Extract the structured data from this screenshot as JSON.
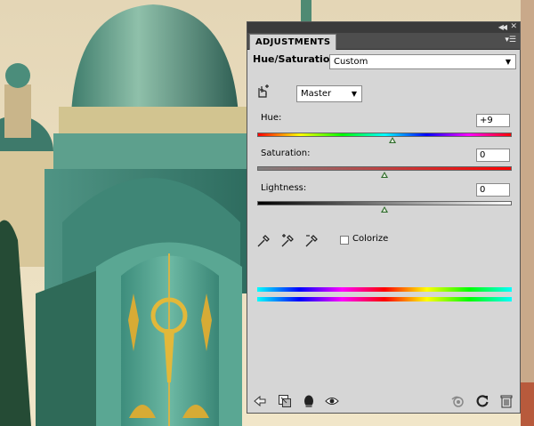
{
  "panel": {
    "tab_label": "ADJUSTMENTS",
    "adjustment_title": "Hue/Saturation",
    "preset": {
      "selected": "Custom"
    },
    "channel": {
      "selected": "Master"
    },
    "hue": {
      "label": "Hue:",
      "value": "+9",
      "slider_fraction": 0.53
    },
    "saturation": {
      "label": "Saturation:",
      "value": "0",
      "slider_fraction": 0.5
    },
    "lightness": {
      "label": "Lightness:",
      "value": "0",
      "slider_fraction": 0.5
    },
    "colorize": {
      "label": "Colorize",
      "checked": false
    },
    "icons": {
      "header": [
        "collapse-icon",
        "close-icon",
        "panel-menu-icon"
      ],
      "tools": [
        "on-image-adjust-icon",
        "eyedropper-icon",
        "eyedropper-plus-icon",
        "eyedropper-minus-icon"
      ],
      "footer": [
        "back-arrow-icon",
        "clip-to-layer-icon",
        "visibility-eye-icon",
        "view-previous-icon",
        "reset-icon",
        "trash-icon"
      ]
    }
  },
  "colors": {
    "panel_bg": "#d6d6d6",
    "tabbar_bg": "#4e4e4e",
    "slider_thumb": "#2d6b2a"
  }
}
